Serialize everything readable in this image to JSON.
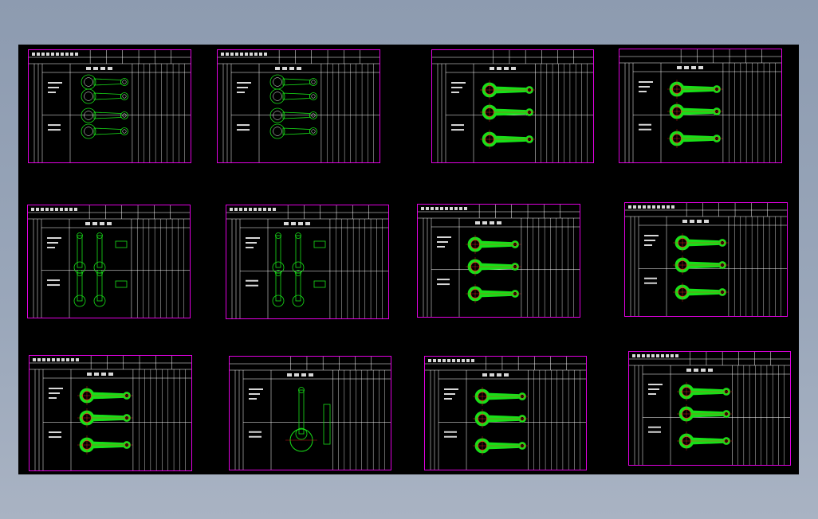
{
  "app": {
    "title": ""
  },
  "colors": {
    "background": "#000000",
    "frame": "#e000e0",
    "part": "#18e018",
    "hole": "#ff2020",
    "text": "#d8d8d8",
    "grid": "#ffffff"
  },
  "sheets": [
    {
      "id": "s1",
      "variant": "outline",
      "titled": true
    },
    {
      "id": "s2",
      "variant": "outline",
      "titled": true
    },
    {
      "id": "s3",
      "variant": "filled",
      "titled": false
    },
    {
      "id": "s4",
      "variant": "filled",
      "titled": false
    },
    {
      "id": "s5",
      "variant": "vertical",
      "titled": true
    },
    {
      "id": "s6",
      "variant": "vertical",
      "titled": true
    },
    {
      "id": "s7",
      "variant": "filled",
      "titled": true
    },
    {
      "id": "s8",
      "variant": "filled",
      "titled": true
    },
    {
      "id": "s9",
      "variant": "filled",
      "titled": true
    },
    {
      "id": "s10",
      "variant": "assembly",
      "titled": false
    },
    {
      "id": "s11",
      "variant": "filled",
      "titled": true
    },
    {
      "id": "s12",
      "variant": "filled",
      "titled": true
    }
  ]
}
